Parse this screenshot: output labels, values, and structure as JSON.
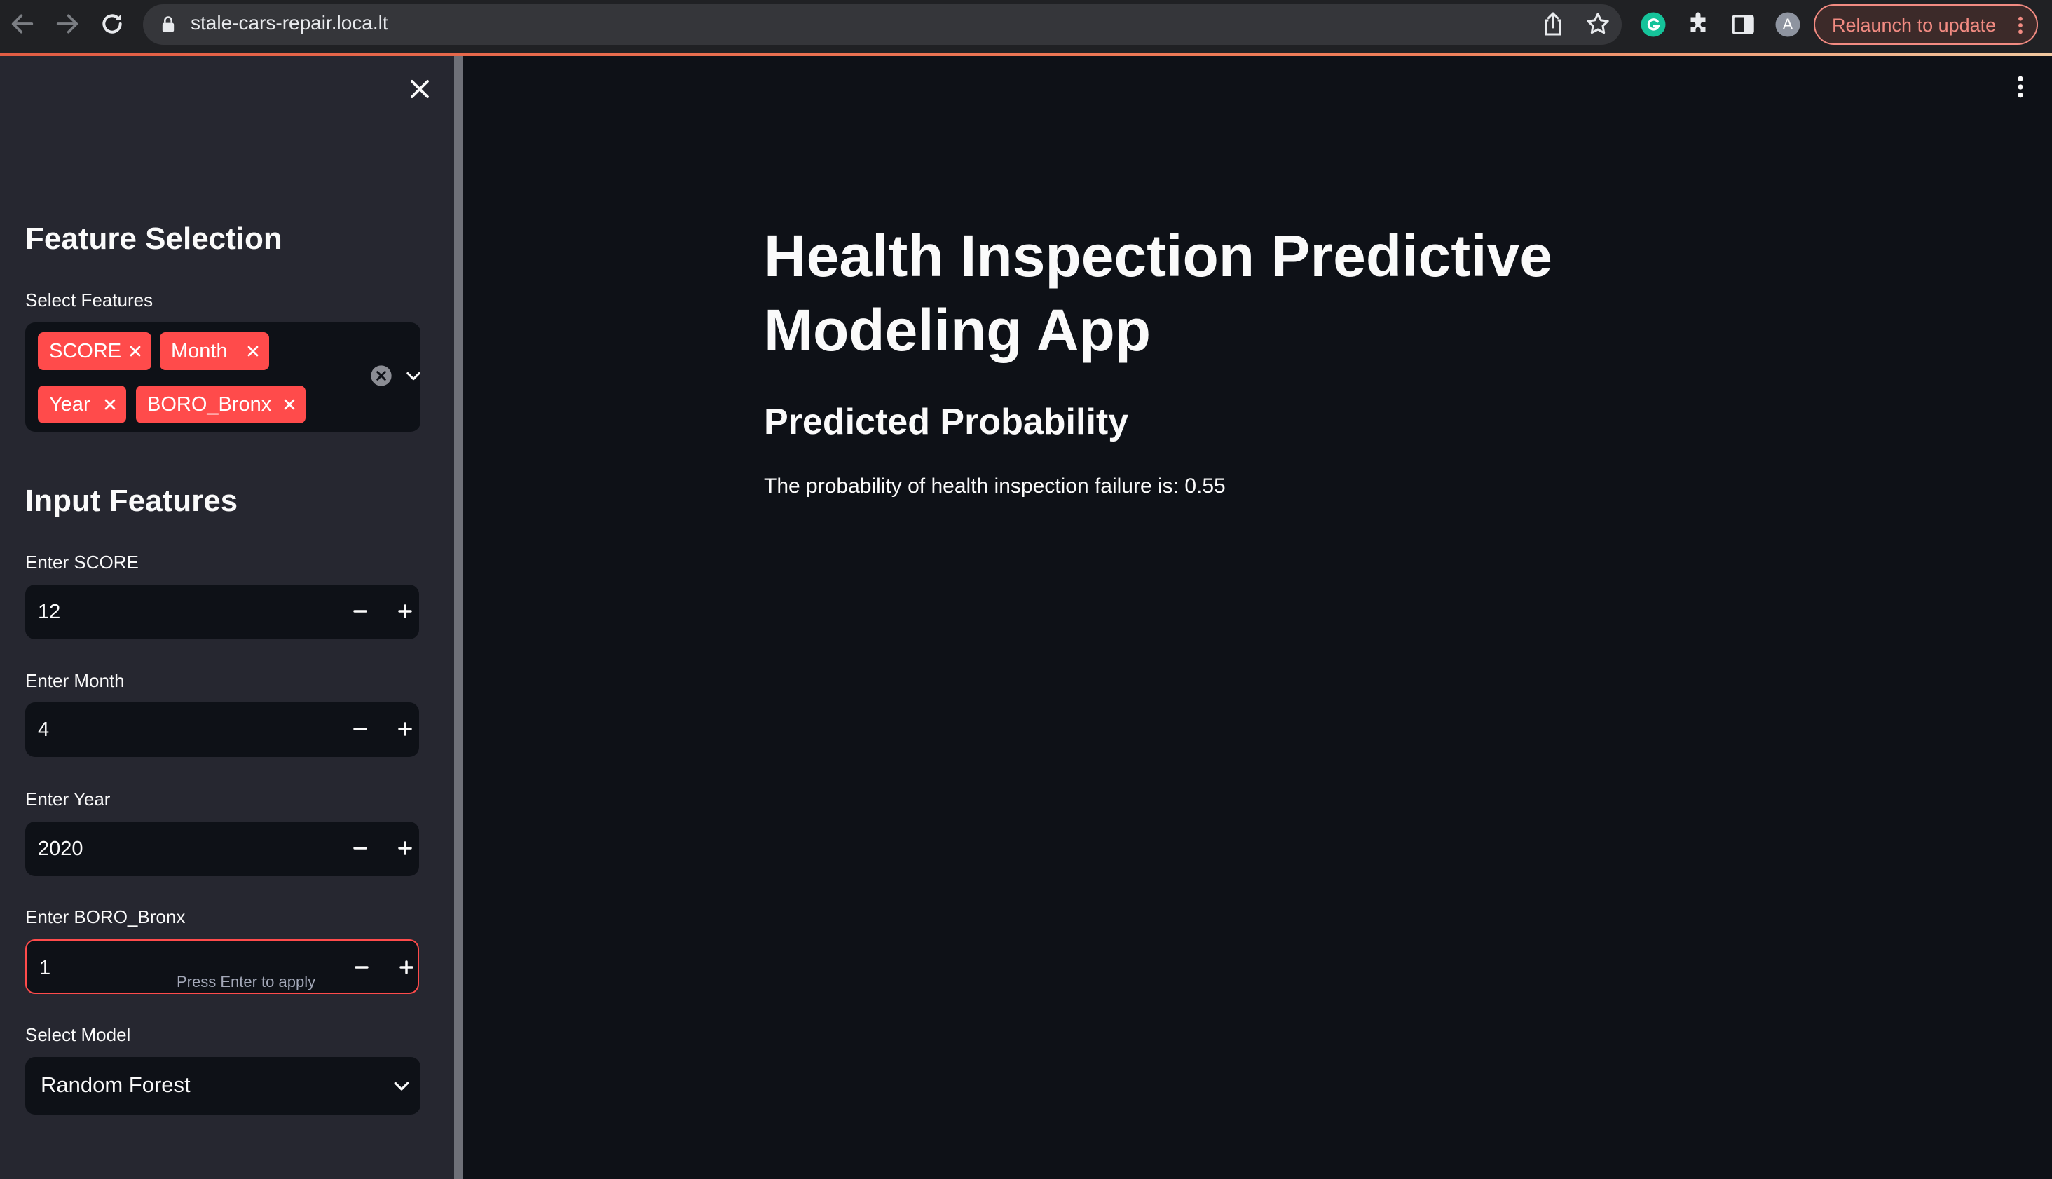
{
  "browser": {
    "url": "stale-cars-repair.loca.lt",
    "profile_initial": "A",
    "relaunch_label": "Relaunch to update",
    "toolbar_icons": [
      "back-arrow-icon",
      "forward-arrow-icon",
      "reload-icon",
      "lock-icon",
      "share-icon",
      "star-icon",
      "grammarly-icon",
      "extensions-puzzle-icon",
      "side-panel-icon",
      "profile-avatar",
      "kebab-menu-icon"
    ]
  },
  "sidebar": {
    "feature_selection_title": "Feature Selection",
    "select_features_label": "Select Features",
    "selected_features": [
      "SCORE",
      "Month",
      "Year",
      "BORO_Bronx"
    ],
    "input_features_title": "Input Features",
    "inputs": [
      {
        "label": "Enter SCORE",
        "value": "12"
      },
      {
        "label": "Enter Month",
        "value": "4"
      },
      {
        "label": "Enter Year",
        "value": "2020"
      },
      {
        "label": "Enter BORO_Bronx",
        "value": "1",
        "hint": "Press Enter to apply"
      }
    ],
    "select_model_label": "Select Model",
    "selected_model": "Random Forest"
  },
  "main": {
    "title": "Health Inspection Predictive Modeling App",
    "subheader": "Predicted Probability",
    "result_text": "The probability of health inspection failure is: 0.55"
  },
  "colors": {
    "accent": "#ff4b4b",
    "background": "#0e1117",
    "sidebar": "#262730",
    "text": "#fafafa",
    "browser_chrome": "#202124",
    "relaunch": "#f28b82"
  }
}
